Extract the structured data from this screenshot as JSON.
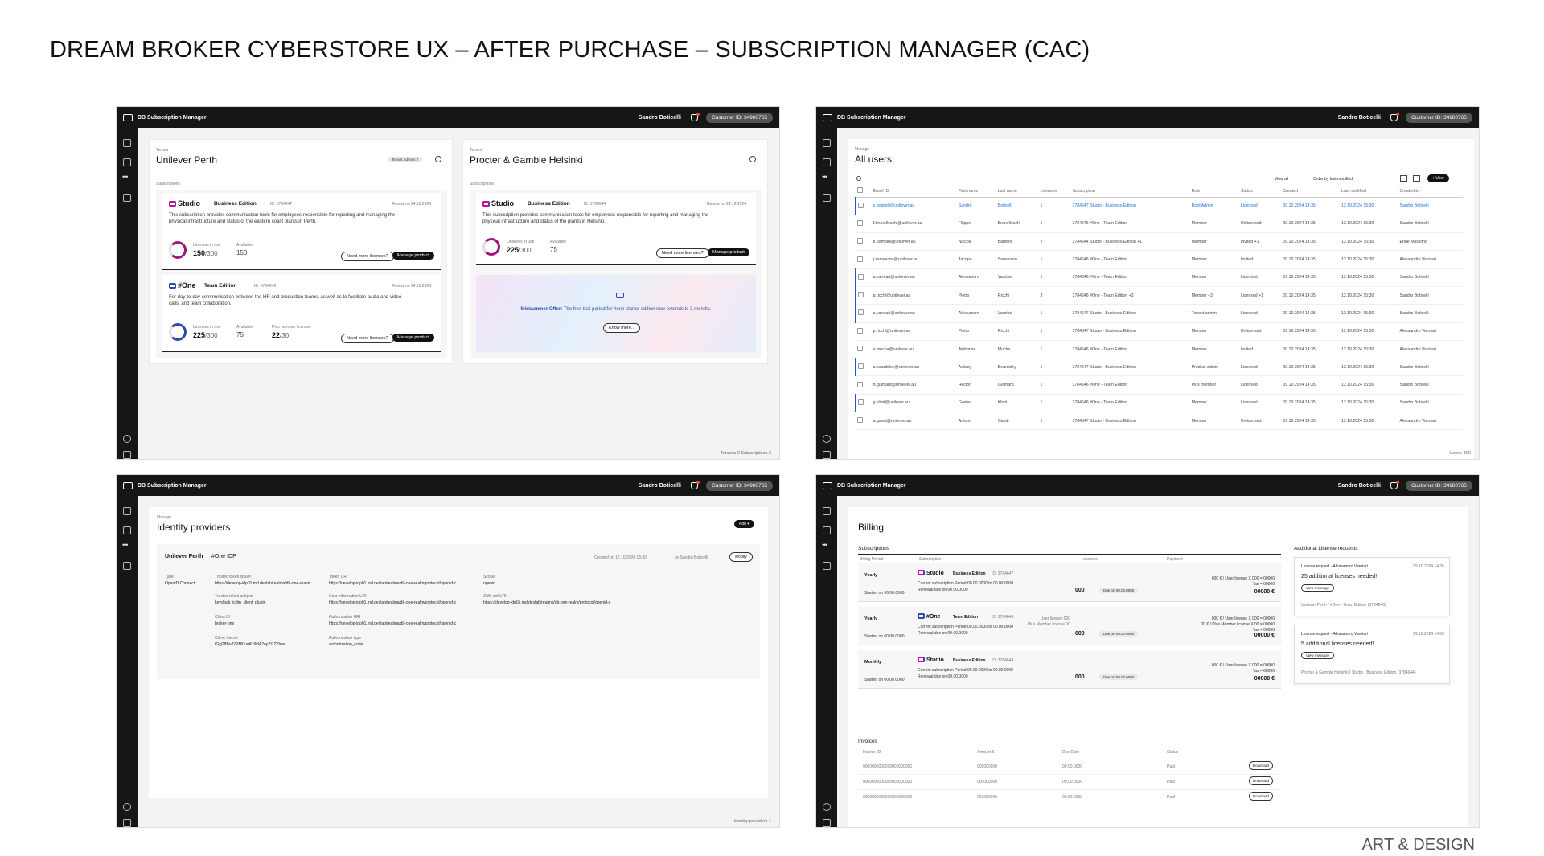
{
  "header": {
    "title": "DREAM BROKER CYBERSTORE UX – AFTER PURCHASE – SUBSCRIPTION MANAGER (CAC)",
    "footer": "ART & DESIGN"
  },
  "app": {
    "name": "DB Subscription Manager",
    "user": "Sandro Boticelli",
    "customer_id": "Customer ID: 34980765"
  },
  "tenants": {
    "status": "Tenants 2    Subscriptions 3",
    "subscriptions_label": "Subscriptions",
    "tenant_label": "Tenant",
    "left": {
      "name": "Unilever Perth",
      "admin_badge": "Tenant Admins 2",
      "sub1": {
        "brand": "Studio",
        "edition": "Business Edition",
        "id": "ID: 3784647",
        "renew": "Renew on 24.12.2024",
        "desc": "This subscription provides communication tools for employees responsible for reporting and managing the physical infrastructure and status of the eastern coast plants in Perth.",
        "in_use_label": "Licenses in use",
        "in_use": "150",
        "total": "/300",
        "available_label": "Available",
        "available": "150",
        "need": "Need more licenses?",
        "manage": "Manage product"
      },
      "sub2": {
        "brand": "One",
        "edition": "Team Edition",
        "id": "ID: 3784646",
        "renew": "Renew on 24.12.2024",
        "desc": "For day-to-day communication between the HR and production teams, as well as to facilitate audio and video calls, and team collaboration.",
        "in_use_label": "Licenses in use",
        "in_use": "225",
        "total": "/300",
        "available_label": "Available",
        "available": "75",
        "plus_label": "Plus member licenses",
        "plus": "22",
        "plus_total": "/30",
        "need": "Need more licenses?",
        "manage": "Manage product"
      }
    },
    "right": {
      "name": "Procter & Gamble Helsinki",
      "sub1": {
        "brand": "Studio",
        "edition": "Business Edition",
        "id": "ID: 3784644",
        "renew": "Renew on 24.12.2024",
        "desc": "This subscription provides communication tools for employees responsible for reporting and managing the physical infrastructure and status of the plants in Helsinki.",
        "in_use_label": "Licenses in use",
        "in_use": "225",
        "total": "/300",
        "available_label": "Available",
        "available": "75",
        "need": "Need more licenses?",
        "manage": "Manage product"
      },
      "offer_strong": "Midsummer Offer:",
      "offer": "The free trial period for #one starter edition now extends to 3 months.",
      "know_more": "Know more..."
    }
  },
  "users": {
    "manage_label": "Manage",
    "title": "All users",
    "view": "View all",
    "order": "Order by  last modified",
    "add_user": "User",
    "status": "Users: 300",
    "columns": [
      "Email ID",
      "First name",
      "Last name",
      "Licenses",
      "Subscription",
      "Role",
      "Status",
      "Created",
      "Last modified",
      "Created by"
    ],
    "rows": [
      [
        "s.boticelli@unilever.au",
        "Sandro",
        "Boticelli",
        "1",
        "3784647 Studio - Business Edition",
        "Root Admin",
        "Licensed",
        "09.10.2024 14:35",
        "12.10.2024 15:30",
        "Sandro Boticelli"
      ],
      [
        "f.brunelleschi@unilever.au",
        "Filippo",
        "Brunelleschi",
        "1",
        "3784646 #One - Team Edition",
        "Member",
        "Unlicensed",
        "09.10.2024 14:35",
        "12.10.2024 15:30",
        "Sandro Boticelli"
      ],
      [
        "e.bambini@unilever.au",
        "Niccoli",
        "Bambini",
        "2",
        "3784644 Studio - Business Edition  +1",
        "Member",
        "Invited  +1",
        "09.10.2024 14:35",
        "12.10.2024 15:30",
        "Enne Massimo"
      ],
      [
        "j.sansovino@unilever.au",
        "Jacopo",
        "Sansovino",
        "1",
        "3784646 #One - Team Edition",
        "Member",
        "Invited",
        "09.10.2024 14:35",
        "12.10.2024 15:30",
        "Alessandro Varotari"
      ],
      [
        "a.varotari@unilever.au",
        "Alessandro",
        "Varotari",
        "1",
        "3784646 #One - Team Edition",
        "Member",
        "Licensed",
        "09.10.2024 14:35",
        "12.10.2024 15:30",
        "Sandro Boticelli"
      ],
      [
        "p.ricchi@unilever.au",
        "Pietro",
        "Ricchi",
        "3",
        "3784646 #One - Team Edition  +2",
        "Member  +3",
        "Licensed  +1",
        "09.10.2024 14:35",
        "12.10.2024 15:30",
        "Sandro Boticelli"
      ],
      [
        "a.varotari@unilever.au",
        "Alessandro",
        "Varotari",
        "1",
        "3784647 Studio - Business Edition",
        "Tenant admin",
        "Licensed",
        "09.10.2024 14:35",
        "12.10.2024 15:30",
        "Sandro Boticelli"
      ],
      [
        "p.ricchi@unilever.au",
        "Pietro",
        "Ricchi",
        "1",
        "3784647 Studio - Business Edition",
        "Member",
        "Unlicensed",
        "09.10.2024 14:35",
        "12.10.2024 15:30",
        "Alessandro Varotari"
      ],
      [
        "a.mucha@unilever.au",
        "Alphonse",
        "Mucha",
        "1",
        "3784646 #One - Team Edition",
        "Member",
        "Invited",
        "09.10.2024 14:35",
        "12.10.2024 15:30",
        "Alessandro Varotari"
      ],
      [
        "a.beardsley@unilever.au",
        "Aubrey",
        "Beardsley",
        "1",
        "3784647 Studio - Business Edition",
        "Product admin",
        "Licensed",
        "09.10.2024 14:35",
        "12.10.2024 15:30",
        "Sandro Boticelli"
      ],
      [
        "h.guimard@unilever.au",
        "Hector",
        "Guimard",
        "1",
        "3784646 #One - Team Edition",
        "Plus member",
        "Licensed",
        "09.10.2024 14:35",
        "12.10.2024 15:30",
        "Sandro Boticelli"
      ],
      [
        "g.klimt@unilever.au",
        "Gustav",
        "Klimt",
        "1",
        "3784646 #One - Team Edition",
        "Member",
        "Licensed",
        "09.10.2024 14:35",
        "12.10.2024 15:30",
        "Sandro Boticelli"
      ],
      [
        "a.gaudi@unilever.au",
        "Antoni",
        "Gaudi",
        "1",
        "3784647 Studio - Business Edition",
        "Member",
        "Unlicensed",
        "09.10.2024 14:35",
        "12.10.2024 15:30",
        "Alessandro Varotari"
      ]
    ]
  },
  "idp": {
    "manage_label": "Manage",
    "title": "Identity providers",
    "add": "Add",
    "status": "Identity providers 1",
    "tenant": "Unilever Perth",
    "idp_name": "#One IDP",
    "created": "Created on  12.10.2024  15:30",
    "by": "by  Sandro Boticelli",
    "modify": "Modify",
    "fields": [
      {
        "label": "Type",
        "value": "OpenID Connect"
      },
      {
        "label": "Trusted token issuer",
        "value": "https://develop-idp01.md.devlab/realms/db-one-realm"
      },
      {
        "label": "Token URI",
        "value": "https://develop-idp01.md.devlab/realms/db-one-realm/protocol/openid-c"
      },
      {
        "label": "Scope",
        "value": "openid"
      },
      {
        "label": "Trusted token subject",
        "value": "keycloak_icdm_client_plugin"
      },
      {
        "label": "User information URI",
        "value": "https://develop-idp01.md.devlab/realms/db-one-realm/protocol/openid-c"
      },
      {
        "label": "JWK set URI",
        "value": "https://develop-idp01.md.devlab/realms/db-one-realm/protocol/openid-c"
      },
      {
        "label": "Client ID",
        "value": "broker-one"
      },
      {
        "label": "Authorization URI",
        "value": "https://develop-idp01.md.devlab/realms/db-one-realm/protocol/openid-c"
      },
      {
        "label": "Client Secret",
        "value": "tGyj28Bo82PMCuuKx9HA7eyZG2Yhee"
      },
      {
        "label": "Authorization type",
        "value": "authorization_code"
      }
    ]
  },
  "billing": {
    "title": "Billing",
    "subs_label": "Subscriptions",
    "cols": [
      "Billing Period",
      "Subscription",
      "Licenses",
      "Payment"
    ],
    "rows": [
      {
        "period": "Yearly",
        "brand": "Studio",
        "edition": "Business Edition",
        "id": "ID: 3784647",
        "current": "Current subscription Period  00.00.0000 to 00.00.0000",
        "renewal": "Renewal due on  00.00.0000",
        "started": "Started on  00.00.0000",
        "lic": "000",
        "due": "Due on 00.00.0000",
        "calc": "000 € / User license X 000 = 00000",
        "tax": "Tax = 00000",
        "total": "00000 €"
      },
      {
        "period": "Yearly",
        "brand": "One",
        "edition": "Team Edition",
        "id": "ID: 3784646",
        "current": "Current subscription Period  00.00.0000 to 00.00.0000",
        "renewal": "Renewal due on  00.00.0000",
        "started": "Started on  00.00.0000",
        "lic_user": "User license  000",
        "lic_plus": "Plus Member license  00",
        "lic": "000",
        "due": "Due on 00.00.0000",
        "calc": "000 € / User license X 000 = 00000",
        "calc2": "00 € / Plus Member license X 00 = 00000",
        "tax": "Tax = 00000",
        "total": "00000 €"
      },
      {
        "period": "Monthly",
        "brand": "Studio",
        "edition": "Business Edition",
        "id": "ID: 3784644",
        "current": "Current subscription Period  00.00.0000 to 00.00.0000",
        "renewal": "Renewal due on  00.00.0000",
        "started": "Started on  00.00.0000",
        "lic": "000",
        "due": "Due on 00.00.0000",
        "calc": "000 € / User license X 000 = 00000",
        "tax": "Tax = 00000",
        "total": "00000 €"
      }
    ],
    "invoices_label": "Invoices",
    "inv_cols": [
      "Invoice ID",
      "Amount €",
      "Due Date",
      "Status"
    ],
    "invoices": [
      [
        "0000000000000000000000",
        "000000000",
        "00.00.0000",
        "Paid",
        "Download"
      ],
      [
        "0000000000000000000000",
        "000000000",
        "00.00.0000",
        "Paid",
        "Download"
      ],
      [
        "0000000000000000000000",
        "000000000",
        "00.00.0000",
        "Paid",
        "Download"
      ]
    ],
    "additional_label": "Additional License requests",
    "requests": [
      {
        "title": "License request - Alessandro Varotari",
        "date": "09.10.2024  14:35",
        "text": "25 additional licenses needed!",
        "button": "View message",
        "meta": "Unilever Perth / #One - Team Edition (3784646)"
      },
      {
        "title": "License request - Alessandro Varotari",
        "date": "09.10.2024  14:35",
        "text": "5 additional licenses needed!",
        "button": "View message",
        "meta": "Procter & Gamble Helsinki / Studio - Business Edition (3784644)"
      }
    ]
  }
}
